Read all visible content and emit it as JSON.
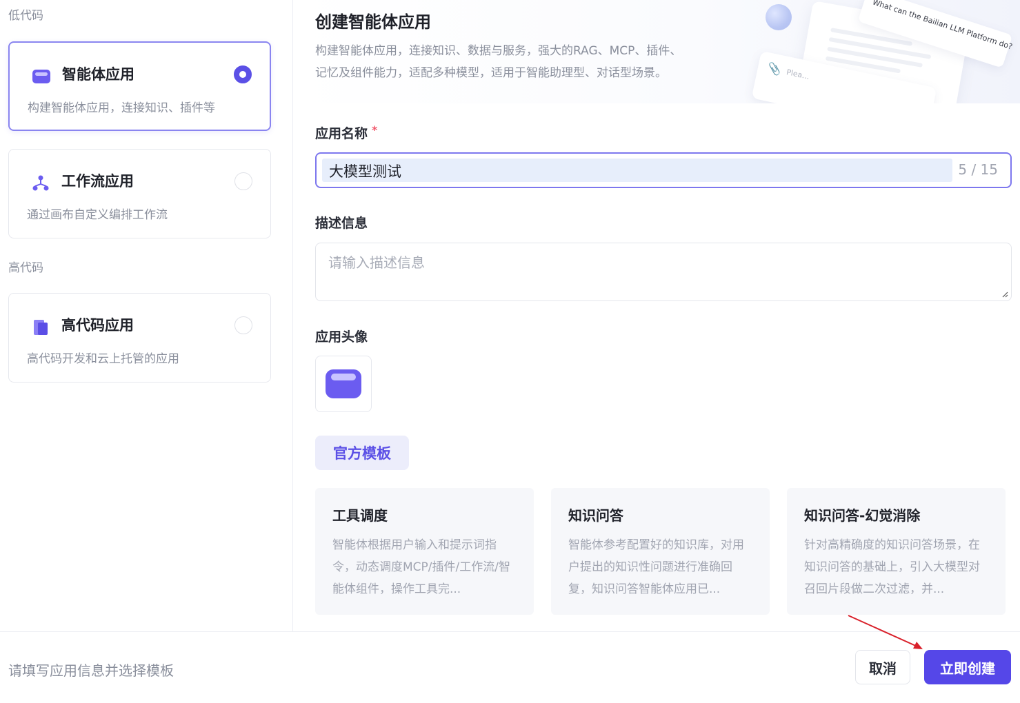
{
  "sidebar": {
    "lowcode_label": "低代码",
    "highcode_label": "高代码",
    "types": [
      {
        "title": "智能体应用",
        "desc": "构建智能体应用，连接知识、插件等",
        "icon": "agent-icon",
        "selected": true
      },
      {
        "title": "工作流应用",
        "desc": "通过画布自定义编排工作流",
        "icon": "workflow-icon",
        "selected": false
      },
      {
        "title": "高代码应用",
        "desc": "高代码开发和云上托管的应用",
        "icon": "code-doc-icon",
        "selected": false
      }
    ]
  },
  "banner": {
    "title": "创建智能体应用",
    "desc_line1": "构建智能体应用，连接知识、数据与服务，强大的RAG、MCP、插件、",
    "desc_line2": "记忆及组件能力，适配多种模型，适用于智能助理型、对话型场景。",
    "deco_question": "What can the Bailian LLM Platform do?",
    "deco_placeholder": "Plea..."
  },
  "form": {
    "name_label": "应用名称",
    "required_mark": "*",
    "name_value": "大模型测试",
    "name_count": "5 / 15",
    "desc_label": "描述信息",
    "desc_placeholder": "请输入描述信息",
    "avatar_label": "应用头像"
  },
  "templates": {
    "tab_label": "官方模板",
    "items": [
      {
        "title": "工具调度",
        "desc": "智能体根据用户输入和提示词指令，动态调度MCP/插件/工作流/智能体组件，操作工具完..."
      },
      {
        "title": "知识问答",
        "desc": "智能体参考配置好的知识库，对用户提出的知识性问题进行准确回复，知识问答智能体应用已..."
      },
      {
        "title": "知识问答-幻觉消除",
        "desc": "针对高精确度的知识问答场景，在知识问答的基础上，引入大模型对召回片段做二次过滤，并..."
      }
    ]
  },
  "footer": {
    "hint": "请填写应用信息并选择模板",
    "cancel_label": "取消",
    "create_label": "立即创建"
  },
  "colors": {
    "accent": "#5547e8",
    "accent_light": "#ecedfb",
    "annotation_arrow": "#d9202a"
  }
}
